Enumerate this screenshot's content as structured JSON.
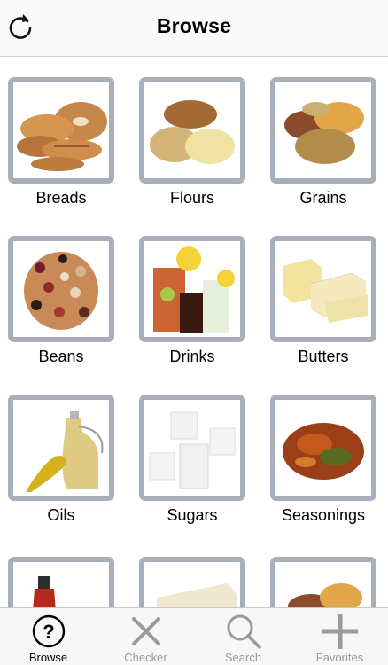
{
  "header": {
    "title": "Browse"
  },
  "categories": [
    {
      "label": "Breads"
    },
    {
      "label": "Flours"
    },
    {
      "label": "Grains"
    },
    {
      "label": "Beans"
    },
    {
      "label": "Drinks"
    },
    {
      "label": "Butters"
    },
    {
      "label": "Oils"
    },
    {
      "label": "Sugars"
    },
    {
      "label": "Seasonings"
    }
  ],
  "tabbar": {
    "tabs": [
      {
        "label": "Browse",
        "icon": "question-circle-icon",
        "active": true
      },
      {
        "label": "Checker",
        "icon": "x-icon",
        "active": false
      },
      {
        "label": "Search",
        "icon": "magnifier-icon",
        "active": false
      },
      {
        "label": "Favorites",
        "icon": "plus-icon",
        "active": false
      }
    ]
  },
  "colors": {
    "frame": "#a9afba",
    "tab_active": "#000000",
    "tab_inactive": "#9a9a9a"
  }
}
